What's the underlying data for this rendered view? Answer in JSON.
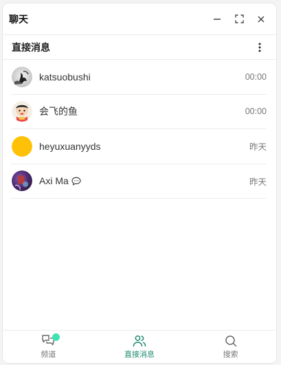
{
  "window": {
    "title": "聊天"
  },
  "section": {
    "title": "直接消息"
  },
  "dms": [
    {
      "name": "katsuobushi",
      "time": "00:00",
      "avatar": "ink-figure",
      "has_chat_icon": false
    },
    {
      "name": "会飞的鱼",
      "time": "00:00",
      "avatar": "cartoon-kid",
      "has_chat_icon": false
    },
    {
      "name": "heyuxuanyyds",
      "time": "昨天",
      "avatar": "yellow-circle",
      "has_chat_icon": false
    },
    {
      "name": "Axi Ma",
      "time": "昨天",
      "avatar": "purple-art",
      "has_chat_icon": true
    }
  ],
  "nav": {
    "items": [
      {
        "label": "频道",
        "icon": "channels-icon",
        "active": false,
        "badge": true
      },
      {
        "label": "直接消息",
        "icon": "users-icon",
        "active": true,
        "badge": false
      },
      {
        "label": "搜索",
        "icon": "search-icon",
        "active": false,
        "badge": false
      }
    ]
  },
  "colors": {
    "accent": "#1f8a6f",
    "badge": "#3fe3b1",
    "yellow_avatar": "#ffc107"
  }
}
